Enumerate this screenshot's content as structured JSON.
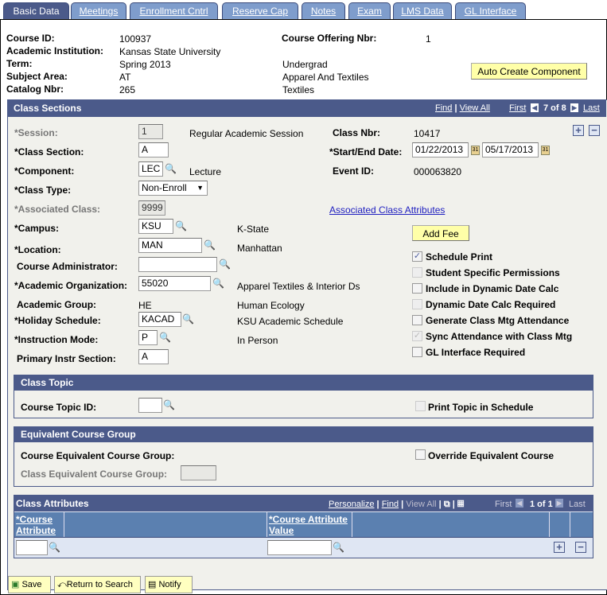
{
  "tabs": [
    "Basic Data",
    "Meetings",
    "Enrollment Cntrl",
    "Reserve Cap",
    "Notes",
    "Exam",
    "LMS Data",
    "GL Interface"
  ],
  "course": {
    "course_id_label": "Course ID:",
    "course_id": "100937",
    "institution_label": "Academic Institution:",
    "institution": "Kansas State University",
    "term_label": "Term:",
    "term": "Spring 2013",
    "career": "Undergrad",
    "subject_label": "Subject Area:",
    "subject": "AT",
    "subject_desc": "Apparel And Textiles",
    "catalog_label": "Catalog Nbr:",
    "catalog": "265",
    "catalog_desc": "Textiles",
    "offering_label": "Course Offering Nbr:",
    "offering": "1",
    "auto_create": "Auto Create Component"
  },
  "class_sections": {
    "title": "Class Sections",
    "find": "Find",
    "view_all": "View All",
    "first": "First",
    "count": "7 of 8",
    "last": "Last",
    "session_label": "*Session:",
    "session": "1",
    "session_desc": "Regular Academic Session",
    "section_label": "*Class Section:",
    "section": "A",
    "component_label": "*Component:",
    "component": "LEC",
    "component_desc": "Lecture",
    "class_type_label": "*Class Type:",
    "class_type": "Non-Enroll",
    "assoc_label": "*Associated Class:",
    "assoc": "9999",
    "campus_label": "*Campus:",
    "campus": "KSU",
    "campus_desc": "K-State",
    "location_label": "*Location:",
    "location": "MAN",
    "location_desc": "Manhattan",
    "admin_label": "Course Administrator:",
    "admin": "",
    "org_label": "*Academic Organization:",
    "org": "55020",
    "org_desc": "Apparel Textiles & Interior Ds",
    "group_label": "Academic Group:",
    "group": "HE",
    "group_desc": "Human Ecology",
    "holiday_label": "*Holiday Schedule:",
    "holiday": "KACAD",
    "holiday_desc": "KSU Academic Schedule",
    "mode_label": "*Instruction Mode:",
    "mode": "P",
    "mode_desc": "In Person",
    "primary_label": "Primary Instr Section:",
    "primary": "A",
    "class_nbr_label": "Class Nbr:",
    "class_nbr": "10417",
    "dates_label": "*Start/End Date:",
    "start": "01/22/2013",
    "end": "05/17/2013",
    "event_label": "Event ID:",
    "event": "000063820",
    "assoc_attr_link": "Associated Class Attributes",
    "add_fee": "Add Fee",
    "checkboxes": [
      {
        "label": "Schedule Print",
        "checked": true,
        "disabled": false
      },
      {
        "label": "Student Specific Permissions",
        "checked": false,
        "disabled": true
      },
      {
        "label": "Include in Dynamic Date Calc",
        "checked": false,
        "disabled": false
      },
      {
        "label": "Dynamic Date Calc Required",
        "checked": false,
        "disabled": true
      },
      {
        "label": "Generate Class Mtg Attendance",
        "checked": false,
        "disabled": false
      },
      {
        "label": "Sync Attendance with Class Mtg",
        "checked": true,
        "disabled": true
      },
      {
        "label": "GL Interface Required",
        "checked": false,
        "disabled": false
      }
    ]
  },
  "class_topic": {
    "title": "Class Topic",
    "topic_label": "Course Topic ID:",
    "topic": "",
    "print_label": "Print Topic in Schedule"
  },
  "equiv": {
    "title": "Equivalent Course Group",
    "course_label": "Course Equivalent Course Group:",
    "class_label": "Class Equivalent Course Group:",
    "override_label": "Override Equivalent Course"
  },
  "attrs": {
    "title": "Class Attributes",
    "personalize": "Personalize",
    "find": "Find",
    "view_all": "View All",
    "first": "First",
    "count": "1 of 1",
    "last": "Last",
    "col1a": "*Course",
    "col1b": "Attribute",
    "col2a": "*Course Attribute",
    "col2b": "Value"
  },
  "toolbar": {
    "save": "Save",
    "return": "Return to Search",
    "notify": "Notify"
  }
}
